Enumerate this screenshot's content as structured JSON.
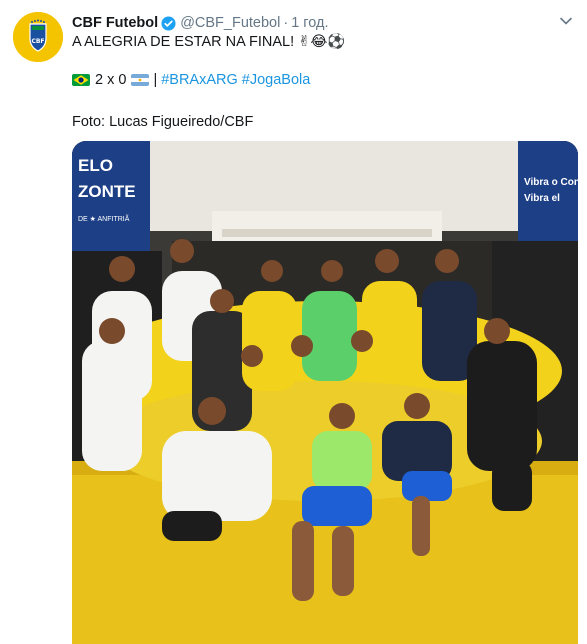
{
  "tweet": {
    "display_name": "CBF Futebol",
    "handle": "@CBF_Futebol",
    "separator": "·",
    "timestamp": "1 год.",
    "line1_text": "A ALEGRIA DE ESTAR NA FINAL!",
    "line1_emojis": "✌😂⚽",
    "score": "2 x 0",
    "pipe": "|",
    "hashtags": [
      "#BRAxARG",
      "#JogaBola"
    ],
    "photo_credit": "Foto: Lucas Figueiredo/CBF",
    "photo_banner_left": [
      "ELO",
      "ZONTE",
      "DE ★ ANFITRIÃ"
    ],
    "photo_banner_right": [
      "Vibra o Conti",
      "Vibra el"
    ]
  },
  "icons": {
    "avatar": "cbf-crest-icon",
    "verified": "verified-badge-icon",
    "caret": "chevron-down-icon",
    "flag_left": "brazil-flag-icon",
    "flag_right": "argentina-flag-icon"
  },
  "colors": {
    "link": "#1b95e0",
    "muted": "#657786",
    "verified": "#1da1f2",
    "avatar_bg": "#f5c400",
    "floor": "#e8c21a",
    "jersey": "#f3d21c"
  }
}
